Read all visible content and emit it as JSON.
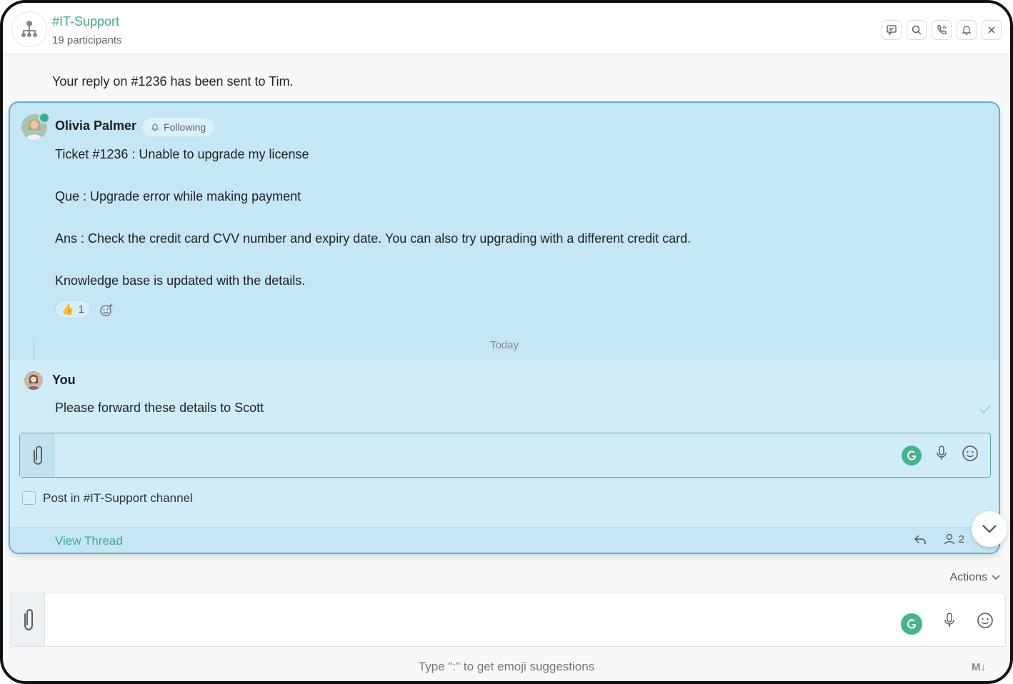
{
  "header": {
    "channel_name": "#IT-Support",
    "participants": "19 participants",
    "icons": [
      "chat-icon",
      "search-icon",
      "call-icon",
      "bell-icon",
      "close-icon"
    ]
  },
  "notice": "Your reply on #1236 has been sent to Tim.",
  "thread": {
    "author": "Olivia Palmer",
    "following_label": "Following",
    "lines": [
      "Ticket #1236 : Unable to upgrade my license",
      "Que : Upgrade error while making payment",
      "Ans : Check the credit card CVV number and expiry date. You can also try upgrading with a different credit card.",
      "Knowledge base is updated with the details."
    ],
    "reaction": {
      "emoji": "👍",
      "count": "1"
    },
    "date_divider": "Today",
    "reply": {
      "author": "You",
      "text": "Please forward these details to Scott"
    },
    "post_in_channel_label": "Post in #IT-Support channel",
    "view_thread": "View Thread",
    "participant_count": "2"
  },
  "actions_label": "Actions",
  "composer": {
    "hint": "Type \":\" to get emoji suggestions",
    "markdown_label": "M↓"
  },
  "colors": {
    "accent": "#3fae8c",
    "thread_bg": "#c5e6f4",
    "thread_border": "#5bb1d9"
  }
}
